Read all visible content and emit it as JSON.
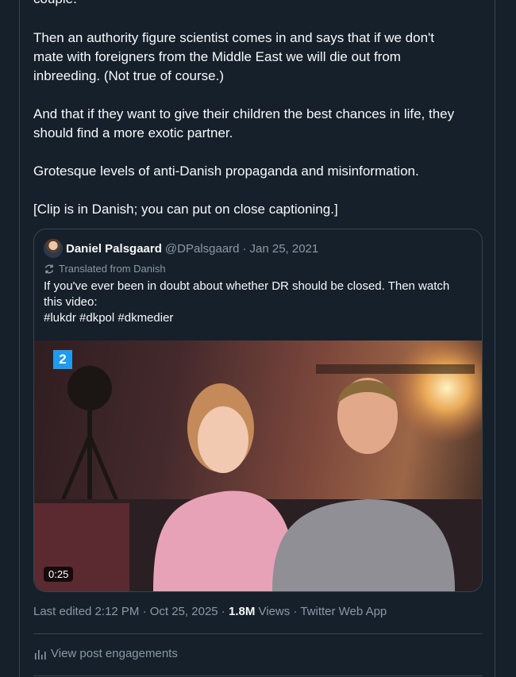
{
  "post": {
    "lines": [
      "couple.",
      "Then an authority figure scientist comes in and says that if we don't",
      "mate with foreigners from the Middle East we will die out from",
      "inbreeding. (Not true of course.)",
      "And that if they want to give their children the best chances in life, they",
      "should find a more exotic partner.",
      "Grotesque levels of anti-Danish propaganda and misinformation.",
      "[Clip is in Danish; you can put on close captioning.]"
    ]
  },
  "quote": {
    "name": "Daniel Palsgaard",
    "handle": "@DPalsgaard",
    "separator": "·",
    "date": "Jan 25, 2021",
    "translated_label": "Translated from Danish",
    "body_lines": [
      "If you've ever been in doubt about whether DR should be closed. Then watch",
      "this video:",
      "#lukdr #dkpol #dkmedier"
    ],
    "media": {
      "channel_badge": "2",
      "duration": "0:25"
    }
  },
  "meta": {
    "edited": "Last edited 2:12 PM · Oct 25, 2025 · ",
    "views_count": "1.8M",
    "views_label": " Views · ",
    "source": "Twitter Web App"
  },
  "engagements_label": "View post engagements",
  "colors": {
    "background": "#15202b",
    "border": "#38444d",
    "muted": "#8b98a5",
    "accent": "#1d9bf0"
  }
}
